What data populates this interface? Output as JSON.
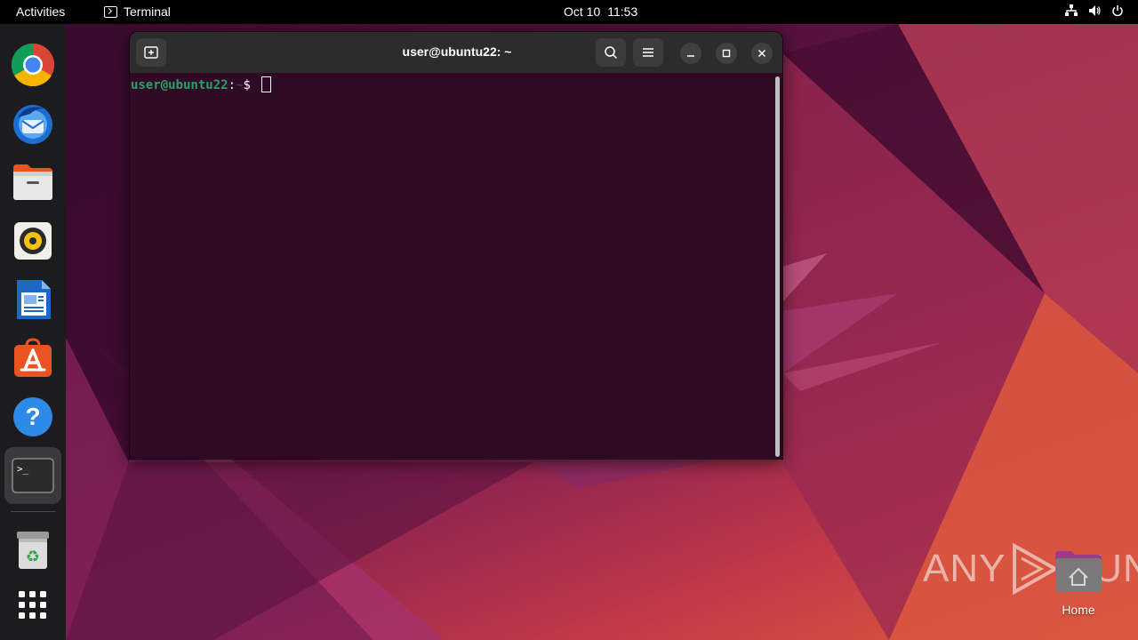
{
  "topbar": {
    "activities": "Activities",
    "app_menu": "Terminal",
    "date": "Oct 10",
    "time": "11:53",
    "tray_icons": [
      "network-icon",
      "volume-icon",
      "power-icon"
    ]
  },
  "dock": {
    "items": [
      {
        "name": "chrome",
        "icon": "chrome-icon"
      },
      {
        "name": "thunderbird",
        "icon": "thunderbird-icon"
      },
      {
        "name": "files",
        "icon": "files-icon"
      },
      {
        "name": "rhythmbox",
        "icon": "rhythmbox-icon"
      },
      {
        "name": "libreoffice-writer",
        "icon": "writer-icon"
      },
      {
        "name": "software",
        "icon": "software-center-icon"
      },
      {
        "name": "help",
        "icon": "help-icon"
      },
      {
        "name": "terminal",
        "icon": "terminal-icon",
        "running": true,
        "active": true
      },
      {
        "name": "trash",
        "icon": "trash-icon"
      },
      {
        "name": "show-apps",
        "icon": "app-grid-icon"
      }
    ]
  },
  "terminal": {
    "title": "user@ubuntu22: ~",
    "prompt_user": "user@ubuntu22",
    "prompt_sep": ":",
    "prompt_path": "~",
    "prompt_symbol": "$ "
  },
  "desktop": {
    "home_label": "Home"
  },
  "watermark": {
    "left": "ANY",
    "right": "RUN"
  },
  "colors": {
    "accent": "#e95420",
    "terminal_bg": "#300a24",
    "prompt_user": "#26a269",
    "prompt_path": "#12488b"
  }
}
